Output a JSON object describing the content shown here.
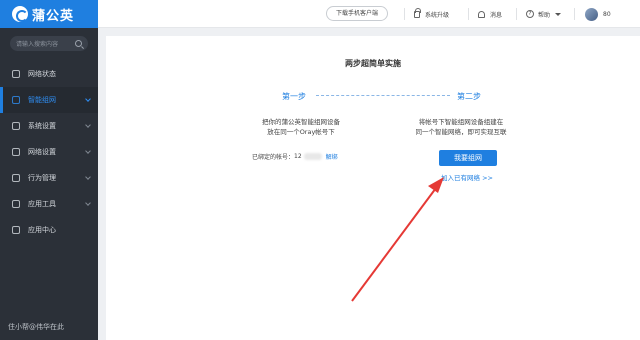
{
  "sidebar": {
    "logo_text": "蒲公英",
    "search_placeholder": "请输入搜索内容",
    "items": [
      {
        "label": "网络状态",
        "icon": "network-status-icon",
        "has_arrow": false,
        "active": false
      },
      {
        "label": "智能组网",
        "icon": "smart-network-icon",
        "has_arrow": true,
        "active": true
      },
      {
        "label": "系统设置",
        "icon": "gear-icon",
        "has_arrow": true,
        "active": false
      },
      {
        "label": "网络设置",
        "icon": "network-settings-icon",
        "has_arrow": true,
        "active": false
      },
      {
        "label": "行为管理",
        "icon": "behavior-icon",
        "has_arrow": true,
        "active": false
      },
      {
        "label": "应用工具",
        "icon": "tools-icon",
        "has_arrow": true,
        "active": false
      },
      {
        "label": "应用中心",
        "icon": "app-center-icon",
        "has_arrow": false,
        "active": false
      }
    ],
    "footer": "住小帮@伟华在此"
  },
  "topbar": {
    "download_button": "下载手机客户端",
    "upgrade": "系统升级",
    "messages": "消息",
    "help": "帮助",
    "user": "80"
  },
  "main": {
    "title": "两步超简单实施",
    "step1": "第一步",
    "step2": "第二步",
    "step1_desc_line1": "把你的蒲公英智能组网设备",
    "step1_desc_line2": "放在同一个Oray帐号下",
    "bound_account_label": "已绑定的帐号：",
    "account_prefix": "12",
    "unbind": "解绑",
    "step2_desc_line1": "将帐号下智能组网设备组建在",
    "step2_desc_line2": "同一个智能网络，即可实现互联",
    "create_button": "我要组网",
    "join_link": "加入已有网络 >>"
  },
  "colors": {
    "accent": "#1f7fe0",
    "sidebar_bg": "#2b3038",
    "annotation_arrow": "#e53935"
  }
}
